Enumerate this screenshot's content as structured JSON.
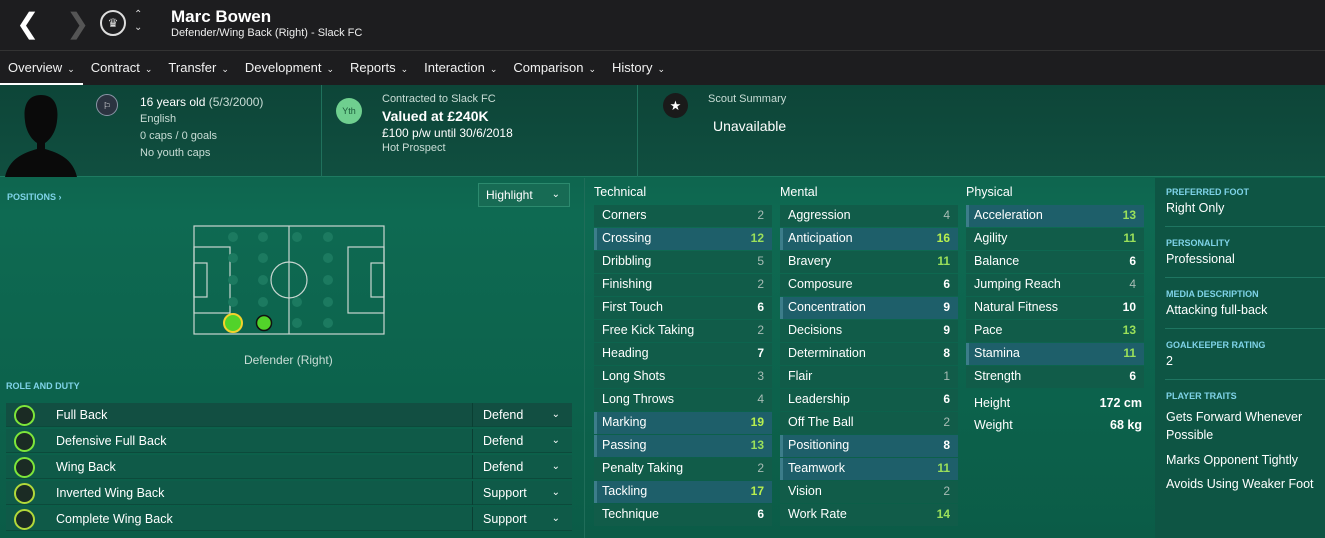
{
  "player": {
    "name": "Marc Bowen",
    "subtitle": "Defender/Wing Back (Right) - Slack FC"
  },
  "tabs": [
    {
      "label": "Overview"
    },
    {
      "label": "Contract"
    },
    {
      "label": "Transfer"
    },
    {
      "label": "Development"
    },
    {
      "label": "Reports"
    },
    {
      "label": "Interaction"
    },
    {
      "label": "Comparison"
    },
    {
      "label": "History"
    }
  ],
  "bio": {
    "age": "16 years old",
    "dob": "(5/3/2000)",
    "nationality": "English",
    "caps": "0 caps / 0 goals",
    "youth_caps": "No youth caps"
  },
  "contract": {
    "badge": "Yth",
    "contracted": "Contracted to Slack FC",
    "value": "Valued at £240K",
    "wage": "£100 p/w until 30/6/2018",
    "status": "Hot Prospect"
  },
  "scout": {
    "label": "Scout Summary",
    "value": "Unavailable"
  },
  "positions": {
    "label": "POSITIONS",
    "highlight_label": "Highlight",
    "position_name": "Defender (Right)"
  },
  "roles": {
    "label": "ROLE AND DUTY",
    "items": [
      {
        "name": "Full Back",
        "duty": "Defend"
      },
      {
        "name": "Defensive Full Back",
        "duty": "Defend"
      },
      {
        "name": "Wing Back",
        "duty": "Defend"
      },
      {
        "name": "Inverted Wing Back",
        "duty": "Support"
      },
      {
        "name": "Complete Wing Back",
        "duty": "Support"
      }
    ]
  },
  "technical": {
    "label": "Technical",
    "items": [
      {
        "name": "Corners",
        "value": "2"
      },
      {
        "name": "Crossing",
        "value": "12"
      },
      {
        "name": "Dribbling",
        "value": "5"
      },
      {
        "name": "Finishing",
        "value": "2"
      },
      {
        "name": "First Touch",
        "value": "6"
      },
      {
        "name": "Free Kick Taking",
        "value": "2"
      },
      {
        "name": "Heading",
        "value": "7"
      },
      {
        "name": "Long Shots",
        "value": "3"
      },
      {
        "name": "Long Throws",
        "value": "4"
      },
      {
        "name": "Marking",
        "value": "19"
      },
      {
        "name": "Passing",
        "value": "13"
      },
      {
        "name": "Penalty Taking",
        "value": "2"
      },
      {
        "name": "Tackling",
        "value": "17"
      },
      {
        "name": "Technique",
        "value": "6"
      }
    ]
  },
  "mental": {
    "label": "Mental",
    "items": [
      {
        "name": "Aggression",
        "value": "4"
      },
      {
        "name": "Anticipation",
        "value": "16"
      },
      {
        "name": "Bravery",
        "value": "11"
      },
      {
        "name": "Composure",
        "value": "6"
      },
      {
        "name": "Concentration",
        "value": "9"
      },
      {
        "name": "Decisions",
        "value": "9"
      },
      {
        "name": "Determination",
        "value": "8"
      },
      {
        "name": "Flair",
        "value": "1"
      },
      {
        "name": "Leadership",
        "value": "6"
      },
      {
        "name": "Off The Ball",
        "value": "2"
      },
      {
        "name": "Positioning",
        "value": "8"
      },
      {
        "name": "Teamwork",
        "value": "11"
      },
      {
        "name": "Vision",
        "value": "2"
      },
      {
        "name": "Work Rate",
        "value": "14"
      }
    ]
  },
  "physical": {
    "label": "Physical",
    "items": [
      {
        "name": "Acceleration",
        "value": "13"
      },
      {
        "name": "Agility",
        "value": "11"
      },
      {
        "name": "Balance",
        "value": "6"
      },
      {
        "name": "Jumping Reach",
        "value": "4"
      },
      {
        "name": "Natural Fitness",
        "value": "10"
      },
      {
        "name": "Pace",
        "value": "13"
      },
      {
        "name": "Stamina",
        "value": "11"
      },
      {
        "name": "Strength",
        "value": "6"
      }
    ],
    "height_label": "Height",
    "height": "172 cm",
    "weight_label": "Weight",
    "weight": "68 kg"
  },
  "summary": {
    "preferred_foot_label": "PREFERRED FOOT",
    "preferred_foot": "Right Only",
    "personality_label": "PERSONALITY",
    "personality": "Professional",
    "media_label": "MEDIA DESCRIPTION",
    "media": "Attacking full-back",
    "gk_label": "GOALKEEPER RATING",
    "gk": "2",
    "traits_label": "PLAYER TRAITS",
    "traits": [
      "Gets Forward Whenever Possible",
      "Marks Opponent Tightly",
      "Avoids Using Weaker Foot"
    ]
  },
  "colors": {
    "topbar": "#1d1d1f",
    "panel": "#0e6a52",
    "accent_blue": "#7fd3e8",
    "good_green": "#9be05a"
  }
}
